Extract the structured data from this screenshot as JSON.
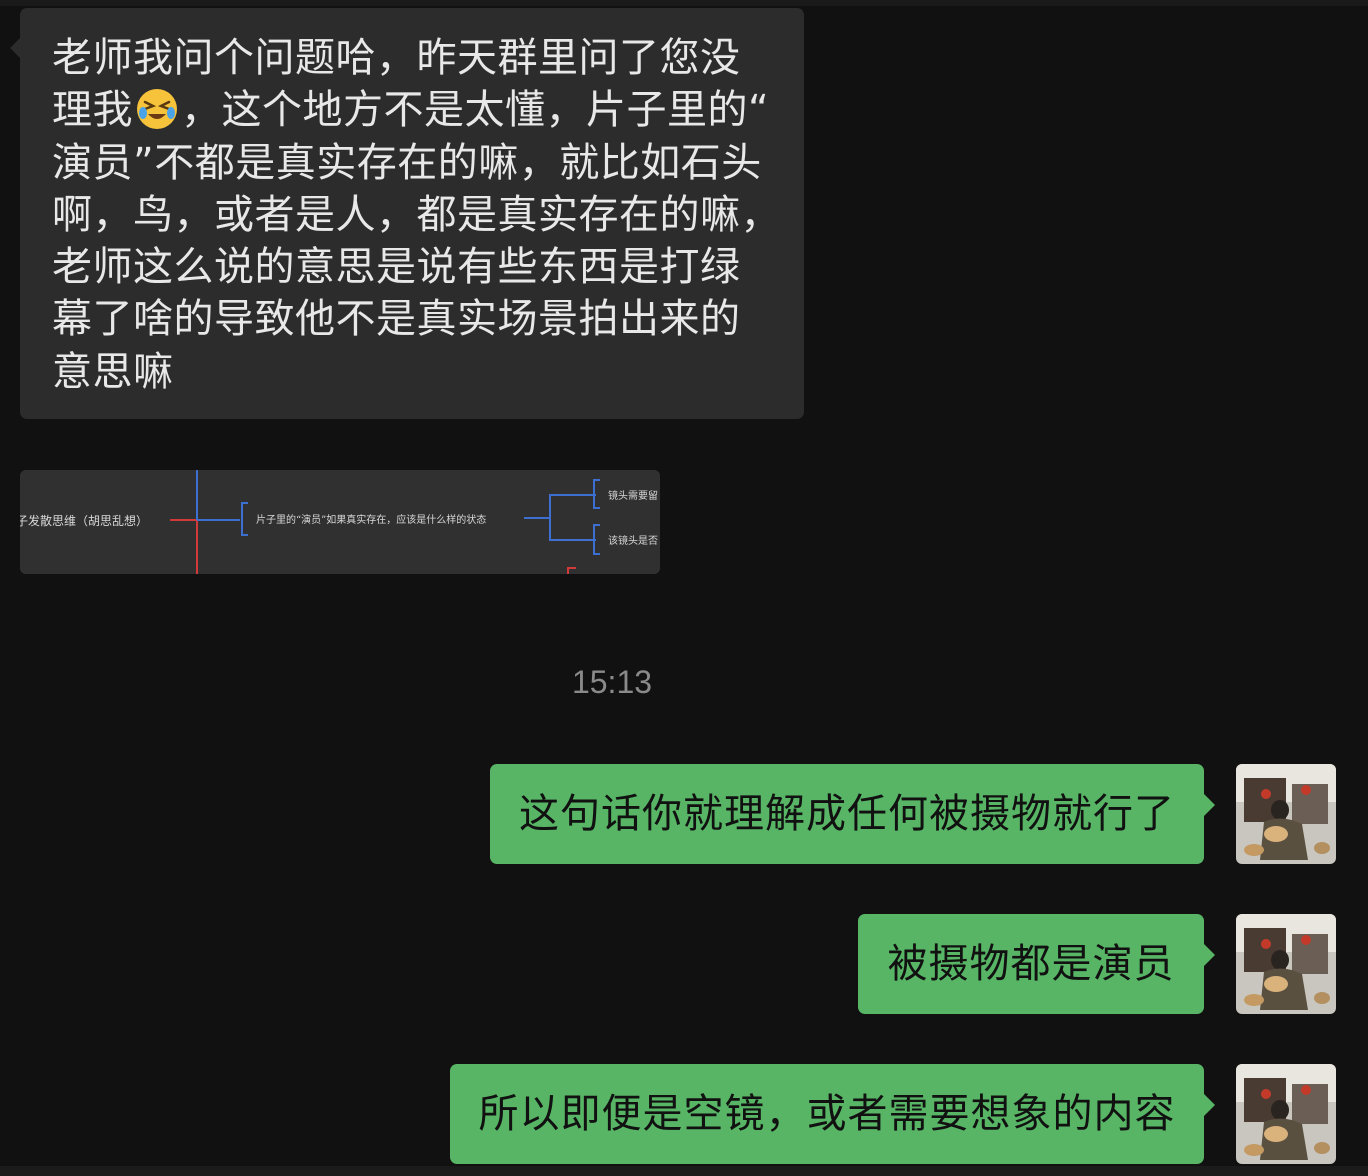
{
  "incoming_message": {
    "lines": [
      "老师我问个问题哈，昨天群里问了您没",
      "理我",
      "，这个地方不是太懂，片子里的“",
      "演员”不都是真实存在的嘛，就比如石头",
      "啊，鸟，或者是人，都是真实存在的嘛，",
      "老师这么说的意思是说有些东西是打绿",
      "幕了啥的导致他不是真实场景拍出来的",
      "意思嘛"
    ],
    "emoji": "crying-laughing-emoji"
  },
  "image_message": {
    "node_root": "子发散思维（胡思乱想）",
    "node_middle": "片子里的“演员”如果真实存在，应该是什么样的状态",
    "node_branch_1": "镜头需要留",
    "node_branch_2": "该镜头是否"
  },
  "timestamp": "15:13",
  "outgoing_messages": [
    {
      "text": "这句话你就理解成任何被摄物就行了"
    },
    {
      "text": "被摄物都是演员"
    },
    {
      "text": "所以即便是空镜，或者需要想象的内容"
    }
  ],
  "colors": {
    "background": "#111111",
    "incoming_bubble": "#2c2c2c",
    "outgoing_bubble": "#57b565",
    "timestamp": "#8a8a8a"
  },
  "icons": {
    "avatar": "user-avatar-photo"
  }
}
